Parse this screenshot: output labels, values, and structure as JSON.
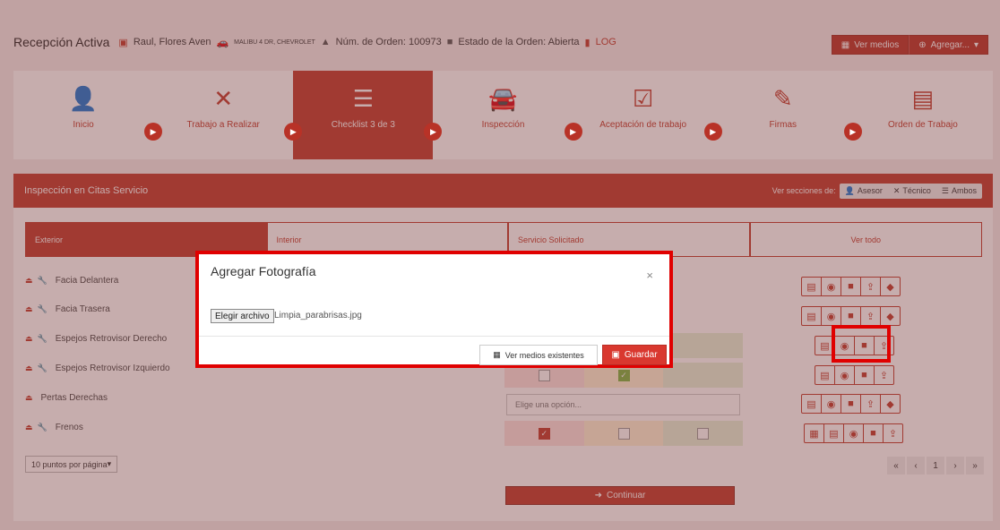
{
  "header": {
    "title": "Recepción Activa",
    "customer": "Raul, Flores Aven",
    "vehicle": "MALIBU 4 DR, CHEVROLET",
    "order_number": "Núm. de Orden: 100973",
    "order_status": "Estado de la Orden: Abierta",
    "log": "LOG",
    "ver_medios": "Ver medios",
    "agregar": "Agregar..."
  },
  "steps": [
    {
      "label": "Inicio",
      "icon": "user-icon"
    },
    {
      "label": "Trabajo a Realizar",
      "icon": "tools-icon"
    },
    {
      "label": "Checklist 3 de 3",
      "icon": "list-icon"
    },
    {
      "label": "Inspección",
      "icon": "car-icon"
    },
    {
      "label": "Aceptación de trabajo",
      "icon": "check-square-icon"
    },
    {
      "label": "Firmas",
      "icon": "signature-icon"
    },
    {
      "label": "Orden de Trabajo",
      "icon": "document-icon"
    }
  ],
  "panel": {
    "title": "Inspección en Citas Servicio",
    "sections_label": "Ver secciones de:",
    "asesor": "Asesor",
    "tecnico": "Técnico",
    "ambos": "Ambos"
  },
  "tabs": [
    "Exterior",
    "Interior",
    "Servicio Solicitado",
    "Ver todo"
  ],
  "rows": [
    {
      "label": "Facia Delantera",
      "wrench": true
    },
    {
      "label": "Facia Trasera",
      "wrench": true
    },
    {
      "label": "Espejos Retrovisor Derecho",
      "wrench": true
    },
    {
      "label": "Espejos Retrovisor Izquierdo",
      "wrench": true
    },
    {
      "label": "Pertas Derechas",
      "wrench": false
    },
    {
      "label": "Frenos",
      "wrench": true
    }
  ],
  "select_placeholder": "Elige una opción...",
  "per_page": "10 puntos por página",
  "pager": [
    "«",
    "‹",
    "1",
    "›",
    "»"
  ],
  "continuar": "Continuar",
  "modal": {
    "title": "Agregar Fotografía",
    "close": "×",
    "file_button": "Elegir archivo",
    "file_name": "Limpia_parabrisas.jpg",
    "ver_existentes": "Ver medios existentes",
    "guardar": "Guardar"
  },
  "colors": {
    "accent": "#c0392b",
    "highlight": "#e00000"
  }
}
